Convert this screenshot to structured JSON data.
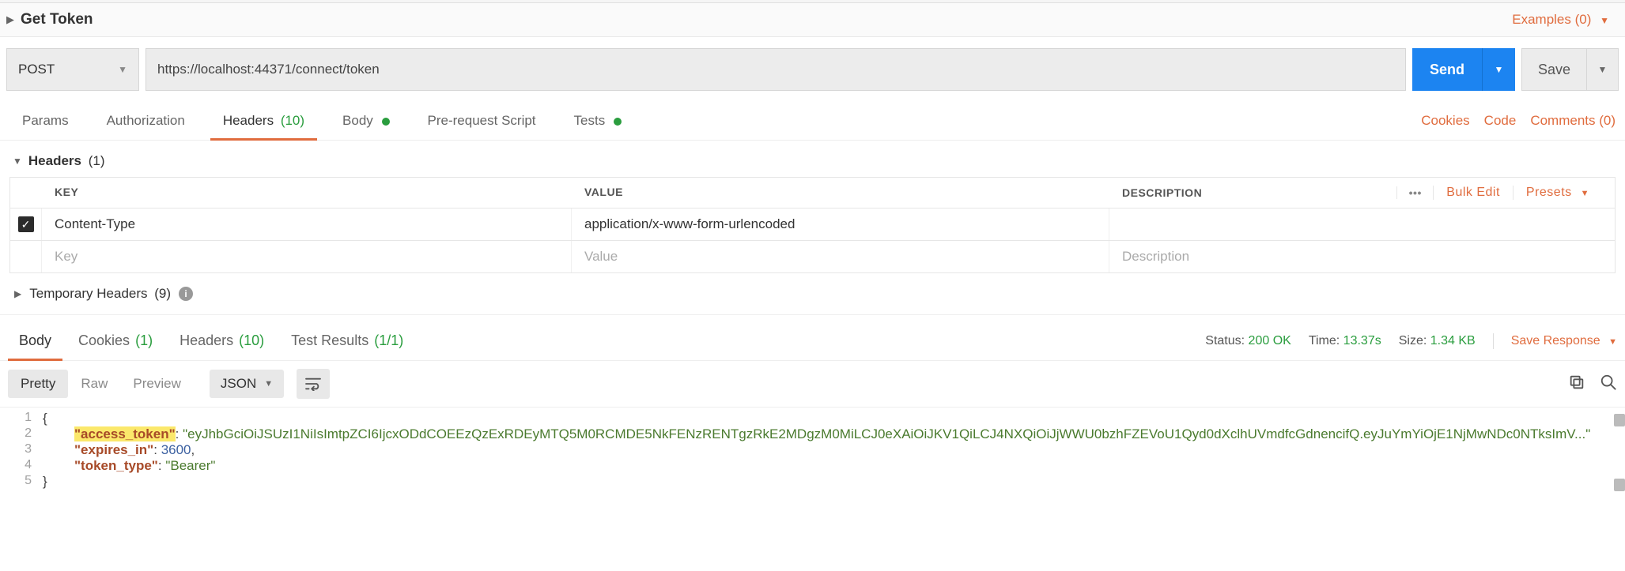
{
  "titlebar": {
    "name": "Get Token",
    "examples": "Examples (0)"
  },
  "request": {
    "method": "POST",
    "url": "https://localhost:44371/connect/token",
    "send": "Send",
    "save": "Save"
  },
  "req_tabs": {
    "params": "Params",
    "auth": "Authorization",
    "headers": "Headers",
    "headers_count": "(10)",
    "body": "Body",
    "pre": "Pre-request Script",
    "tests": "Tests",
    "cookies": "Cookies",
    "code": "Code",
    "comments": "Comments (0)"
  },
  "headers_section": {
    "title": "Headers",
    "count": "(1)",
    "cols": {
      "key": "KEY",
      "value": "VALUE",
      "desc": "DESCRIPTION"
    },
    "actions": {
      "bulk": "Bulk Edit",
      "presets": "Presets"
    },
    "rows": [
      {
        "key": "Content-Type",
        "value": "application/x-www-form-urlencoded",
        "desc": ""
      }
    ],
    "placeholders": {
      "key": "Key",
      "value": "Value",
      "desc": "Description"
    },
    "temp": {
      "label": "Temporary Headers",
      "count": "(9)"
    }
  },
  "resp_tabs": {
    "body": "Body",
    "cookies": "Cookies",
    "cookies_count": "(1)",
    "headers": "Headers",
    "headers_count": "(10)",
    "tests": "Test Results",
    "tests_count": "(1/1)"
  },
  "status": {
    "status_label": "Status:",
    "status_value": "200 OK",
    "time_label": "Time:",
    "time_value": "13.37s",
    "size_label": "Size:",
    "size_value": "1.34 KB",
    "save_response": "Save Response"
  },
  "view": {
    "pretty": "Pretty",
    "raw": "Raw",
    "preview": "Preview",
    "format": "JSON"
  },
  "response_body": {
    "l1": "{",
    "l2_key": "\"access_token\"",
    "l2_val": "\"eyJhbGciOiJSUzI1NiIsImtpZCI6IjcxODdCOEEzQzExRDEyMTQ5M0RCMDE5NkFENzRENTgzRkE2MDgzM0MiLCJ0eXAiOiJKV1QiLCJ4NXQiOiJjWWU0bzhFZEVoU1Qyd0dXclhUVmdfcGdnencifQ.eyJuYmYiOjE1NjMwNDc0NTksImV...\"",
    "l3_key": "\"expires_in\"",
    "l3_val": "3600",
    "l4_key": "\"token_type\"",
    "l4_val": "\"Bearer\"",
    "l5": "}"
  }
}
